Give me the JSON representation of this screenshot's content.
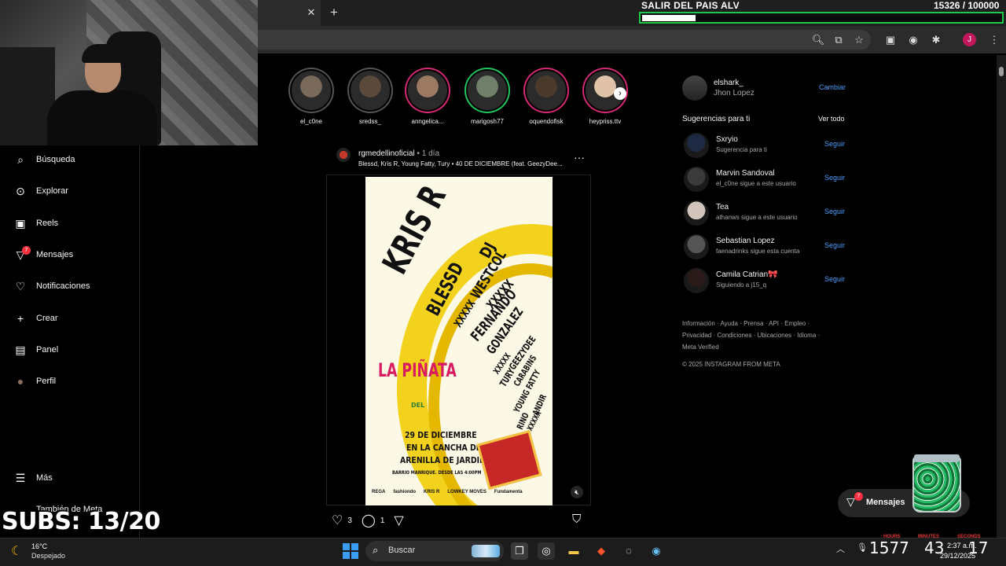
{
  "browser": {
    "new_tab_label": "+",
    "close_tab_label": "✕"
  },
  "overlay": {
    "goal_title": "SALIR DEL PAIS ALV",
    "goal_count": "15326 / 100000",
    "goal_progress": 0.153,
    "subs_text": "SUBS: 13/20",
    "goal_bar_color": "#1ec948"
  },
  "sidebar": {
    "items": [
      {
        "label": "Búsqueda",
        "icon": "search-icon"
      },
      {
        "label": "Explorar",
        "icon": "compass-icon"
      },
      {
        "label": "Reels",
        "icon": "reels-icon"
      },
      {
        "label": "Mensajes",
        "icon": "messages-icon",
        "badge": "7"
      },
      {
        "label": "Notificaciones",
        "icon": "heart-icon"
      },
      {
        "label": "Crear",
        "icon": "plus-icon"
      },
      {
        "label": "Panel",
        "icon": "chart-icon"
      },
      {
        "label": "Perfil",
        "icon": "avatar"
      }
    ],
    "more_label": "Más",
    "meta_label": "También de Meta"
  },
  "stories": [
    {
      "name": "el_c0ne",
      "ring": "#555555"
    },
    {
      "name": "sredss_",
      "ring": "#555555"
    },
    {
      "name": "anngelica...",
      "ring": "#d62976"
    },
    {
      "name": "marigosh77",
      "ring": "#22c55e"
    },
    {
      "name": "oquendofisk",
      "ring": "#d62976"
    },
    {
      "name": "heypriss.ttv",
      "ring": "#d62976"
    }
  ],
  "post": {
    "username": "rgmedellinoficial",
    "time": " • 1 día",
    "subtitle": "Blessd, Kris R, Young Fatty, Tury • 40 DE DICIEMBRE (feat. GeezyDee...",
    "likes": "3",
    "comments": "1",
    "poster": {
      "headline": "KRIS R",
      "line_dj": "DJ",
      "line_westcol": "WESTCOL",
      "line_blessd": "BLESSD",
      "line_x1": "XXXXX",
      "line_x2": "XXXXX",
      "line_fernando": "FERNANDO",
      "line_gonzalez": "GONZALEZ",
      "line_x3": "XXXXX",
      "line_geezydee": "GEEZYDEE",
      "line_tury": "TURY",
      "line_carabins": "CARABINS",
      "line_young": "YOUNG FATTY",
      "line_rino": "RINO",
      "line_andir": "ANDIR",
      "line_x4": "XXXXX",
      "pinata": "LA PIÑATA",
      "pinata_sub": "DEL",
      "date_line1": "29 DE DICIEMBRE",
      "date_line2": "EN LA CANCHA DE",
      "date_line3": "ARENILLA DE JARDIN",
      "date_line4": "BARRIO MANRIQUE. DESDE LAS 4:00PM",
      "sponsors": [
        "REGA",
        "fashiondo",
        "KRIS R",
        "LOWKEY MOVES",
        "Fundamenta"
      ]
    }
  },
  "profile": {
    "username": "elshark_",
    "full_name": "Jhon Lopez",
    "switch_label": "Cambiar"
  },
  "suggestions": {
    "title": "Sugerencias para ti",
    "see_all": "Ver todo",
    "follow_label": "Seguir",
    "items": [
      {
        "name": "Sxryio",
        "sub": "Sugerencia para ti"
      },
      {
        "name": "Marvin Sandoval",
        "sub": "el_c0ne sigue a este usuario"
      },
      {
        "name": "Tea",
        "sub": "athanws sigue a este usuario"
      },
      {
        "name": "Sebastian Lopez",
        "sub": "faenadrinks sigue esta cuenta"
      },
      {
        "name": "Camila Catrian🎀",
        "sub": "Siguiendo a j15_q"
      }
    ]
  },
  "footer": {
    "links_line1": "Información · Ayuda · Prensa · API · Empleo ·",
    "links_line2": "Privacidad · Condiciones · Ubicaciones · Idioma ·",
    "links_line3": "Meta Verified",
    "copyright": "© 2025 INSTAGRAM FROM META"
  },
  "messages_pill": {
    "label": "Mensajes",
    "badge": "7"
  },
  "taskbar": {
    "temp": "16°C",
    "weather": "Despejado",
    "search_placeholder": "Buscar",
    "overlay_num1": "1577",
    "overlay_num2": "43",
    "overlay_num3": "17",
    "label_hours": "HOURS",
    "label_minutes": "MINUTES",
    "label_seconds": "SECONDS",
    "time": "2:37 a.m.",
    "date": "29/12/2025"
  }
}
